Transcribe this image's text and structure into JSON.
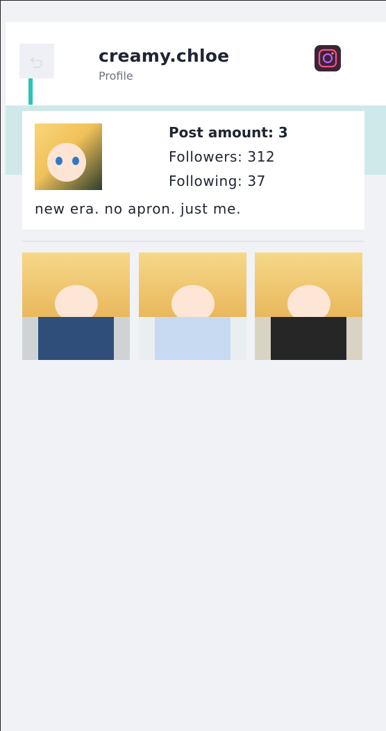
{
  "header": {
    "username": "creamy.chloe",
    "subtitle": "Profile",
    "back_icon": "back-arrow-icon",
    "camera_icon": "instagram-camera-icon",
    "accent_color": "#2bc4b6"
  },
  "profile": {
    "post_amount": "Post amount: 3",
    "followers": "Followers: 312",
    "following": "Following: 37",
    "bio": "new era. no apron. just me."
  },
  "posts": [
    {
      "alt": "selfie photo 1"
    },
    {
      "alt": "selfie photo 2"
    },
    {
      "alt": "selfie photo 3"
    }
  ],
  "colors": {
    "background": "#f0f2f6",
    "band": "#cfe9ea",
    "text": "#1e2433",
    "muted": "#6b7280"
  }
}
